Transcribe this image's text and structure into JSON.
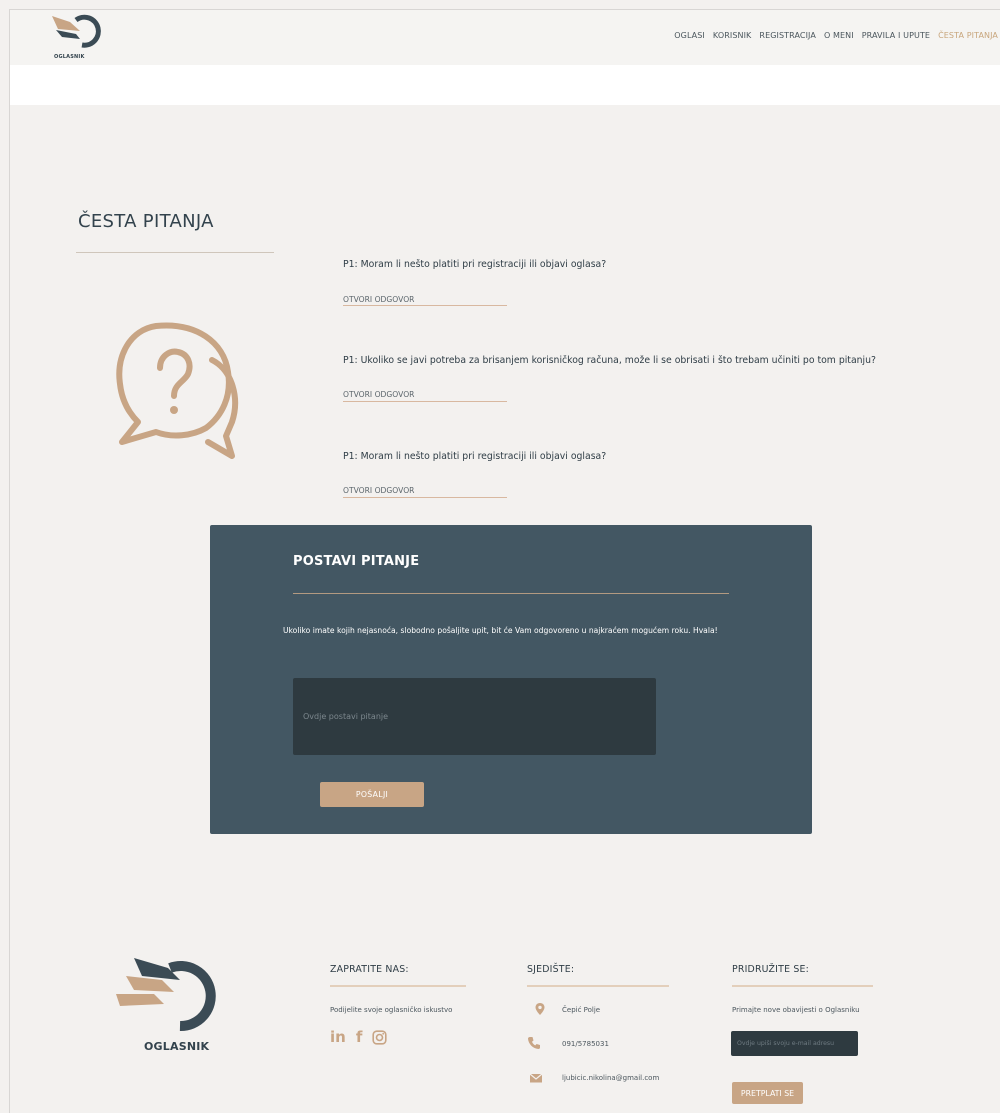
{
  "header": {
    "logo_text": "OGLASNIK",
    "nav": [
      {
        "label": "OGLASI"
      },
      {
        "label": "KORISNIK"
      },
      {
        "label": "REGISTRACIJA"
      },
      {
        "label": "O MENI"
      },
      {
        "label": "PRAVILA I UPUTE"
      },
      {
        "label": "ČESTA PITANJA",
        "active": true
      }
    ]
  },
  "faq": {
    "title": "ČESTA PITANJA",
    "items": [
      {
        "question": "P1: Moram li nešto platiti pri registraciji ili objavi oglasa?",
        "link": "OTVORI ODGOVOR"
      },
      {
        "question": "P1: Ukoliko se javi potreba za brisanjem korisničkog računa, može li se obrisati i što trebam učiniti po tom pitanju?",
        "link": "OTVORI ODGOVOR"
      },
      {
        "question": "P1: Moram li nešto platiti pri registraciji ili objavi oglasa?",
        "link": "OTVORI ODGOVOR"
      }
    ]
  },
  "ask": {
    "title": "POSTAVI PITANJE",
    "description": "Ukoliko imate kojih nejasnoća, slobodno pošaljite upit, bit će Vam odgovoreno u najkraćem mogućem roku. Hvala!",
    "placeholder": "Ovdje postavi pitanje",
    "value": "",
    "button": "POŠALJI"
  },
  "footer": {
    "logo_text": "OGLASNIK",
    "follow": {
      "title": "ZAPRATITE NAS:",
      "text": "Podijelite svoje oglasničko iskustvo",
      "social_icons": [
        "linkedin-icon",
        "facebook-icon",
        "instagram-icon"
      ]
    },
    "hq": {
      "title": "SJEDIŠTE:",
      "location": "Čepić Polje",
      "phone": "091/5785031",
      "email": "ljubicic.nikolina@gmail.com"
    },
    "join": {
      "title": "PRIDRUŽITE SE:",
      "text": "Primajte nove obavijesti o Oglasniku",
      "placeholder": "Ovdje upiši svoju e-mail adresu",
      "value": "",
      "button": "PRETPLATI SE"
    }
  },
  "colors": {
    "accent": "#c8a585",
    "panel": "#435763",
    "dark": "#2e3a40",
    "background": "#f3f1ef"
  }
}
